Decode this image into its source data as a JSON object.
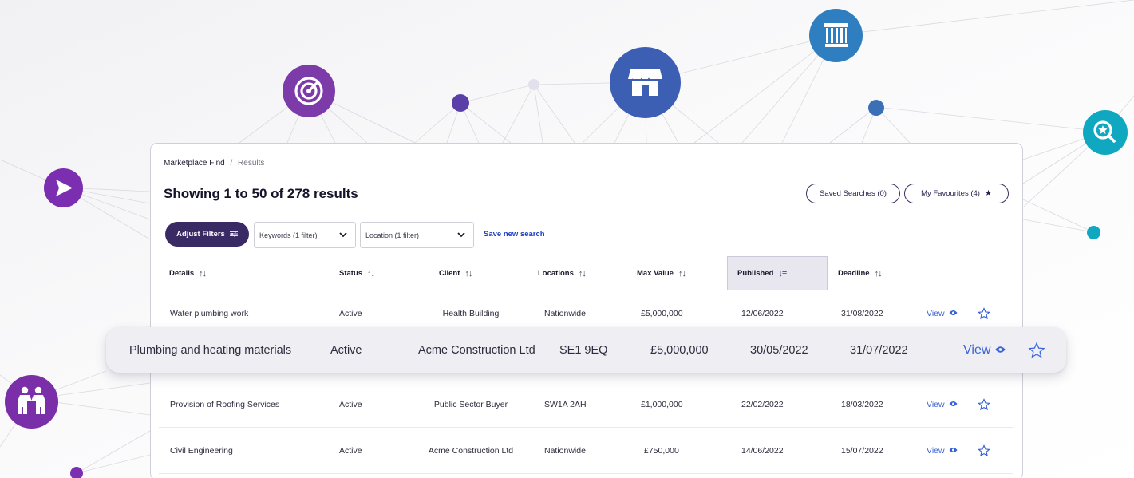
{
  "colors": {
    "purple_dark": "#3a2a63",
    "purple": "#6b3fa8",
    "violet": "#7b2fb0",
    "blue": "#3b6fb6",
    "teal": "#10a8c0",
    "link_blue": "#1e3fc4",
    "line": "#d8d8e0"
  },
  "decor_icons": [
    "send-icon",
    "radar-icon",
    "store-icon",
    "column-icon",
    "search-star-icon",
    "handshake-icon"
  ],
  "breadcrumb": {
    "root": "Marketplace Find",
    "separator": "/",
    "current": "Results"
  },
  "results": {
    "title": "Showing 1 to 50 of 278 results"
  },
  "actions": {
    "saved_searches": "Saved Searches (0)",
    "my_favourites": "My Favourites (4)"
  },
  "filters": {
    "adjust": "Adjust Filters",
    "keywords": "Keywords (1 filter)",
    "location": "Location (1 filter)",
    "save_search": "Save new search"
  },
  "table": {
    "columns": [
      {
        "key": "details",
        "label": "Details"
      },
      {
        "key": "status",
        "label": "Status"
      },
      {
        "key": "client",
        "label": "Client"
      },
      {
        "key": "locations",
        "label": "Locations"
      },
      {
        "key": "max_value",
        "label": "Max Value"
      },
      {
        "key": "published",
        "label": "Published",
        "sorted": "desc"
      },
      {
        "key": "deadline",
        "label": "Deadline"
      }
    ],
    "view_label": "View",
    "rows": [
      {
        "details": "Water plumbing work",
        "status": "Active",
        "client": "Health Building",
        "location": "Nationwide",
        "max_value": "£5,000,000",
        "published": "12/06/2022",
        "deadline": "31/08/2022"
      },
      {
        "details": "Plumbing and heating materials",
        "status": "Active",
        "client": "Acme Construction Ltd",
        "location": "SE1 9EQ",
        "max_value": "£5,000,000",
        "published": "30/05/2022",
        "deadline": "31/07/2022",
        "highlighted": true
      },
      {
        "details": "Provision of Roofing Services",
        "status": "Active",
        "client": "Public Sector Buyer",
        "location": "SW1A 2AH",
        "max_value": "£1,000,000",
        "published": "22/02/2022",
        "deadline": "18/03/2022"
      },
      {
        "details": "Civil Engineering",
        "status": "Active",
        "client": "Acme Construction Ltd",
        "location": "Nationwide",
        "max_value": "£750,000",
        "published": "14/06/2022",
        "deadline": "15/07/2022"
      }
    ]
  }
}
